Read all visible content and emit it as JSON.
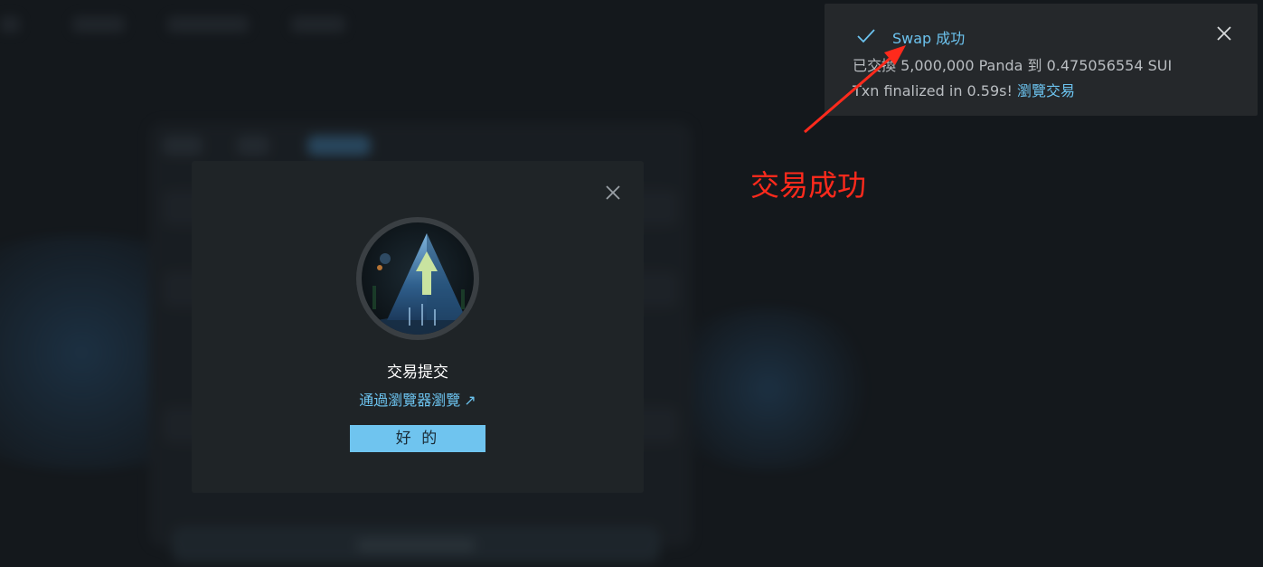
{
  "modal": {
    "title": "交易提交",
    "browser_link": "通過瀏覽器瀏覽",
    "link_arrow": "↗",
    "ok_button": "好 的",
    "close_icon": "close-icon",
    "emblem_icon": "panda-arrow-emblem"
  },
  "toast": {
    "status_icon": "check-icon",
    "title": "Swap 成功",
    "line1": "已交換 5,000,000 Panda 到 0.475056554 SUI",
    "line2_prefix": "Txn finalized in 0.59s!",
    "line2_link": "瀏覽交易",
    "close_icon": "close-icon"
  },
  "annotation": {
    "text": "交易成功",
    "color": "#ff2a1c"
  },
  "colors": {
    "accent": "#6cc3ef",
    "button": "#6fc4ef",
    "modal_bg": "#1f2427",
    "toast_bg": "#25282b"
  }
}
